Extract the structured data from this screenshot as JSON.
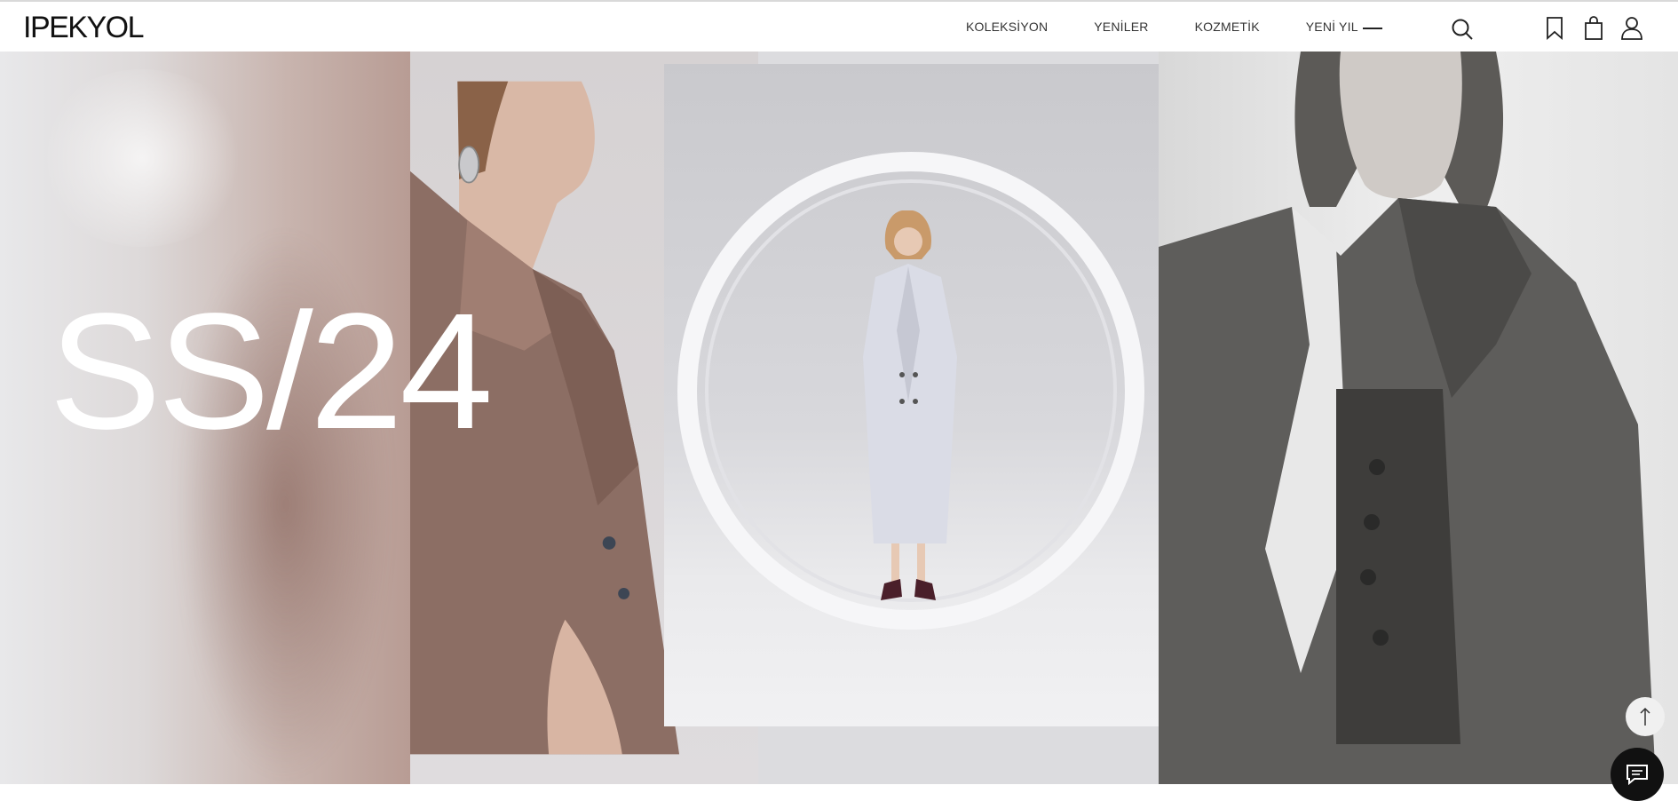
{
  "brand": {
    "logo_text": "IPEKYOL"
  },
  "nav": {
    "items": [
      {
        "label": "KOLEKSİYON"
      },
      {
        "label": "YENİLER"
      },
      {
        "label": "KOZMETİK"
      },
      {
        "label": "YENİ YIL"
      }
    ]
  },
  "header_icons": [
    "menu-icon",
    "search-icon",
    "bookmark-icon",
    "shopping-bag-icon",
    "user-icon"
  ],
  "hero": {
    "headline": "SS/24"
  },
  "floating": {
    "scroll_top_icon": "arrow-up-icon",
    "chat_icon": "chat-bubble-icon"
  },
  "colors": {
    "text": "#111111",
    "background": "#ffffff",
    "headline": "#ffffff",
    "chat_button": "#111111"
  }
}
